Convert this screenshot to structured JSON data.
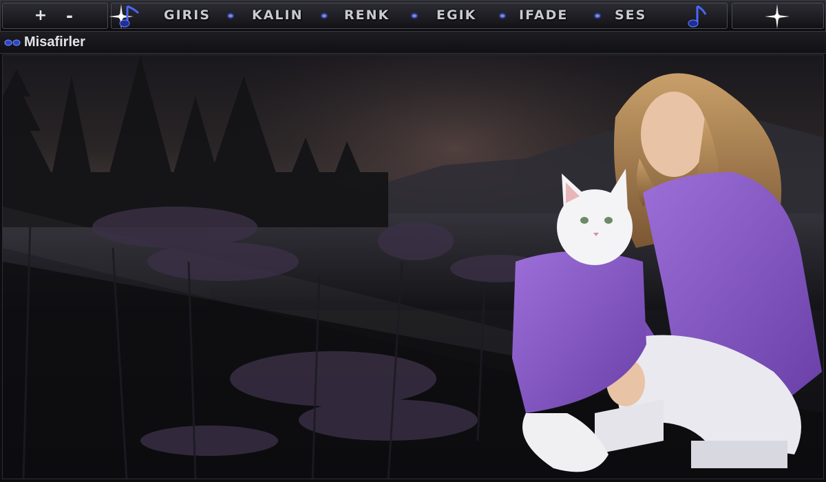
{
  "toolbar": {
    "zoom_in_label": "+",
    "zoom_out_label": "-",
    "nav": [
      {
        "label": "GIRIS"
      },
      {
        "label": "KALIN"
      },
      {
        "label": "RENK"
      },
      {
        "label": "EGIK"
      },
      {
        "label": "IFADE"
      },
      {
        "label": "SES"
      }
    ]
  },
  "room": {
    "name": "Misafirler"
  },
  "colors": {
    "accent": "#3f58ff",
    "sweater": "#8a5cc6",
    "background": "#0d0d10"
  },
  "icons": [
    "sparkle-icon",
    "music-note-icon",
    "users-icon"
  ]
}
